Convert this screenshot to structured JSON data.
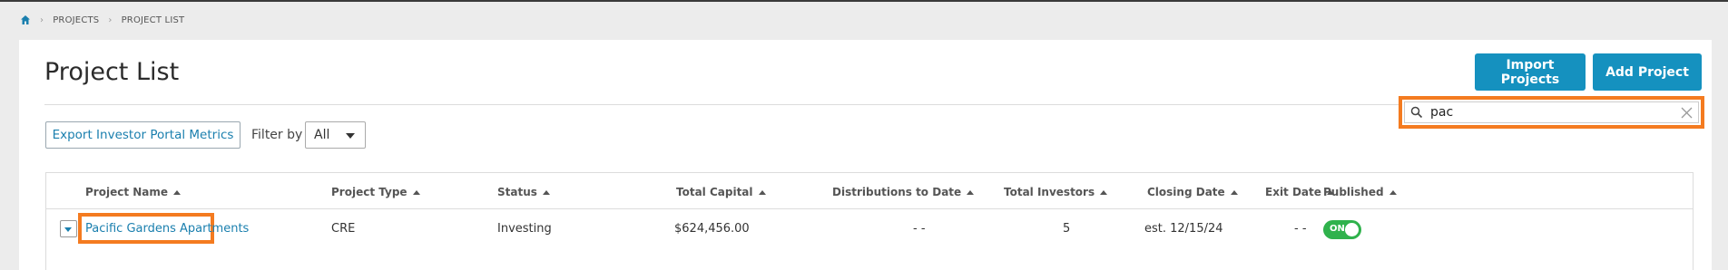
{
  "breadcrumb": {
    "items": [
      "PROJECTS",
      "PROJECT LIST"
    ]
  },
  "header": {
    "title": "Project List",
    "import_label": "Import Projects",
    "add_label": "Add Project"
  },
  "toolbar": {
    "export_label": "Export Investor Portal Metrics",
    "filter_label": "Filter by",
    "filter_value": "All"
  },
  "search": {
    "value": "pac"
  },
  "table": {
    "columns": [
      "Project Name",
      "Project Type",
      "Status",
      "Total Capital",
      "Distributions to Date",
      "Total Investors",
      "Closing Date",
      "Exit Date",
      "Published"
    ],
    "rows": [
      {
        "name": "Pacific Gardens Apartments",
        "type": "CRE",
        "status": "Investing",
        "total_capital": "$624,456.00",
        "distributions": "- -",
        "investors": "5",
        "closing_date": "est. 12/15/24",
        "exit_date": "- -",
        "published": "ON"
      }
    ]
  },
  "colors": {
    "primary": "#1591bf",
    "link": "#1a7fae",
    "highlight": "#f47b20",
    "toggle_on": "#2fb24c"
  },
  "icons": [
    "home-icon",
    "chevron-right-icon",
    "search-icon",
    "clear-icon",
    "sort-up-icon",
    "chevron-down-icon"
  ]
}
